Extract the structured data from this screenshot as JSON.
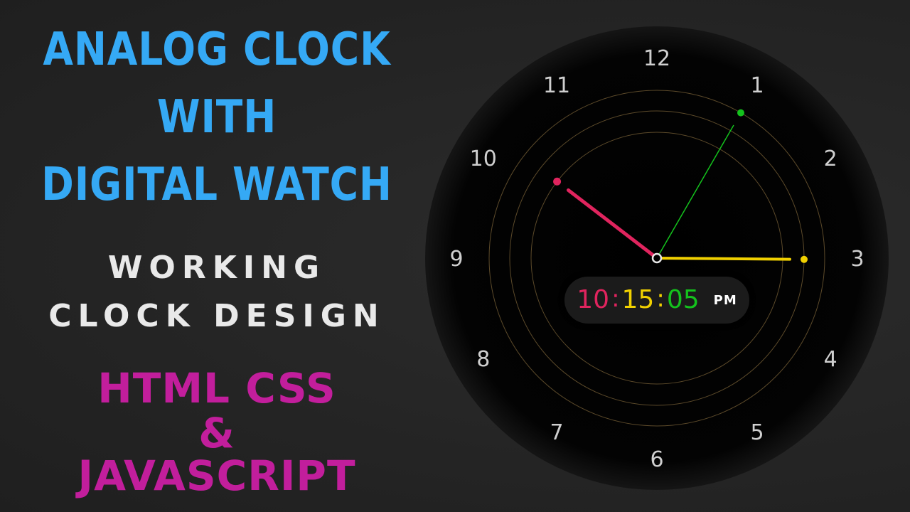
{
  "headline": {
    "line1": "ANALOG CLOCK",
    "line2": "WITH",
    "line3": "DIGITAL WATCH"
  },
  "subtitle": {
    "line1": "WORKING",
    "line2": "CLOCK DESIGN"
  },
  "tech": {
    "line1": "HTML CSS",
    "line2": "&",
    "line3": "JAVASCRIPT"
  },
  "clock": {
    "numerals": [
      "12",
      "1",
      "2",
      "3",
      "4",
      "5",
      "6",
      "7",
      "8",
      "9",
      "10",
      "11"
    ],
    "time": {
      "hours": 10,
      "minutes": 15,
      "seconds": 5
    },
    "digital": {
      "hours": "10",
      "minutes": "15",
      "seconds": "05",
      "sep": ":",
      "ampm": "PM"
    },
    "colors": {
      "hour_hand": "#e0245e",
      "minute_hand": "#f0d000",
      "second_hand": "#14c21d",
      "ring": "#5c4a2a",
      "numerals": "#cfcfcf",
      "headline": "#35a9f5",
      "subtitle": "#e9e9e9",
      "tech": "#c21e9c"
    }
  }
}
